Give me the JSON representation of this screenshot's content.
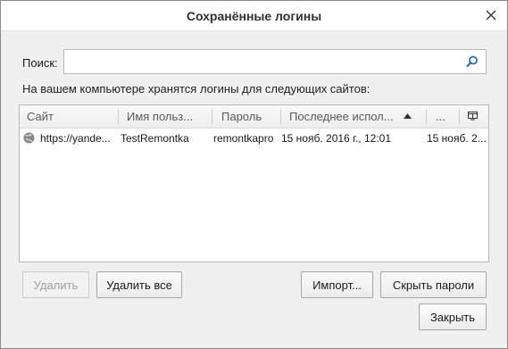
{
  "dialog": {
    "title": "Сохранённые логины"
  },
  "search": {
    "label": "Поиск:",
    "value": "",
    "placeholder": ""
  },
  "description": "На вашем компьютере хранятся логины для следующих сайтов:",
  "table": {
    "columns": [
      {
        "label": "Сайт"
      },
      {
        "label": "Имя польз..."
      },
      {
        "label": "Пароль"
      },
      {
        "label": "Последнее испол..."
      },
      {
        "label": "..."
      }
    ],
    "sort": {
      "column": "Последнее испол...",
      "direction": "ascending"
    },
    "rows": [
      {
        "site": "https://yande...",
        "username": "TestRemontka",
        "password": "remontkapro",
        "last_used": "15 нояб. 2016 г., 12:01",
        "extra": "15 нояб. 2..."
      }
    ]
  },
  "buttons": {
    "remove": "Удалить",
    "remove_all": "Удалить все",
    "import": "Импорт...",
    "hide_passwords": "Скрыть пароли",
    "close": "Закрыть"
  },
  "icons": {
    "close": "close-icon",
    "search": "search-icon",
    "sort": "sort-ascending-icon",
    "column_picker": "column-picker-icon",
    "site": "globe-icon"
  },
  "colors": {
    "search_icon": "#2a6fb5"
  }
}
